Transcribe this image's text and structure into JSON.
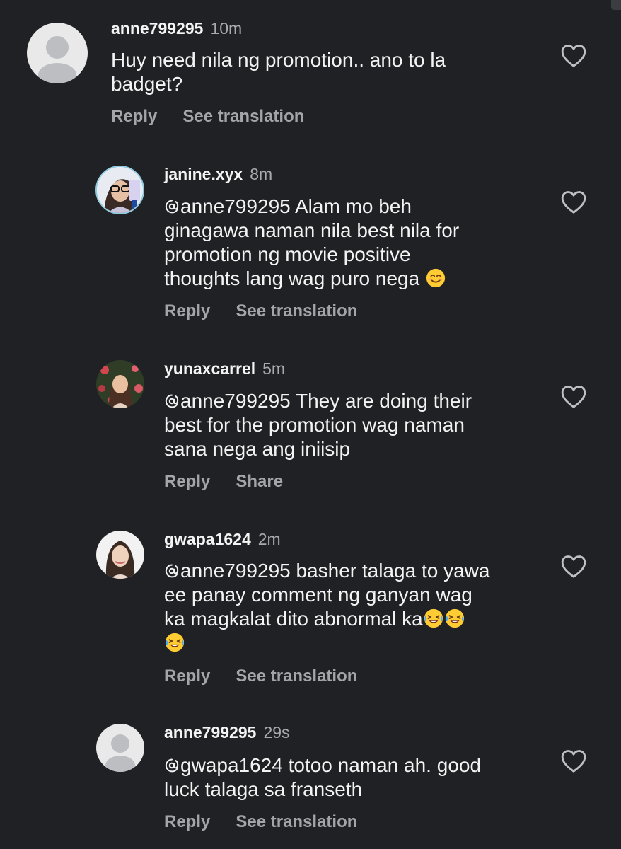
{
  "comments": [
    {
      "username": "anne799295",
      "time": "10m",
      "text_line1": "Huy need nila ng promotion.. ano to la",
      "text_line2": "badget?",
      "reply": "Reply",
      "second_action": "See translation"
    },
    {
      "username": "janine.xyx",
      "time": "8m",
      "mention": "anne799295",
      "text_line1": " Alam mo beh",
      "text_line2": "ginagawa naman nila best nila for",
      "text_line3": "promotion ng movie positive",
      "text_line4": "thoughts lang wag puro nega",
      "reply": "Reply",
      "second_action": "See translation"
    },
    {
      "username": "yunaxcarrel",
      "time": "5m",
      "mention": "anne799295",
      "text_line1": " They are doing their",
      "text_line2": "best for the promotion wag naman",
      "text_line3": "sana nega ang iniisip",
      "reply": "Reply",
      "second_action": "Share"
    },
    {
      "username": "gwapa1624",
      "time": "2m",
      "mention": "anne799295",
      "text_line1": " basher talaga to yawa",
      "text_line2": "ee panay comment ng ganyan wag",
      "text_line3": "ka magkalat dito abnormal ka",
      "reply": "Reply",
      "second_action": "See translation"
    },
    {
      "username": "anne799295",
      "time": "29s",
      "mention": "gwapa1624",
      "text_line1": " totoo naman ah. good",
      "text_line2": "luck talaga sa franseth",
      "reply": "Reply",
      "second_action": "See translation"
    }
  ]
}
